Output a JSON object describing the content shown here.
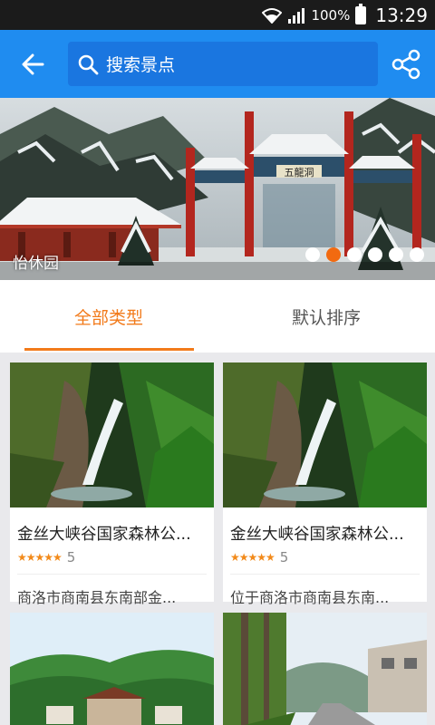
{
  "status_bar": {
    "battery": "100%",
    "time": "13:29"
  },
  "header": {
    "search_placeholder": "搜索景点"
  },
  "banner": {
    "caption": "怡休园",
    "gate_plaque": "五龍洞",
    "dot_count": 6,
    "active_dot": 2
  },
  "tabs": [
    {
      "label": "全部类型",
      "active": true
    },
    {
      "label": "默认排序",
      "active": false
    }
  ],
  "cards": [
    {
      "title": "金丝大峡谷国家森林公...",
      "stars": "★★★★★",
      "score": "5",
      "desc": "商洛市商南县东南部金..."
    },
    {
      "title": "金丝大峡谷国家森林公...",
      "stars": "★★★★★",
      "score": "5",
      "desc": "位于商洛市商南县东南..."
    }
  ],
  "colors": {
    "primary": "#1f8cf0",
    "accent": "#f27a1a",
    "status_bar": "#1b1b1b"
  }
}
